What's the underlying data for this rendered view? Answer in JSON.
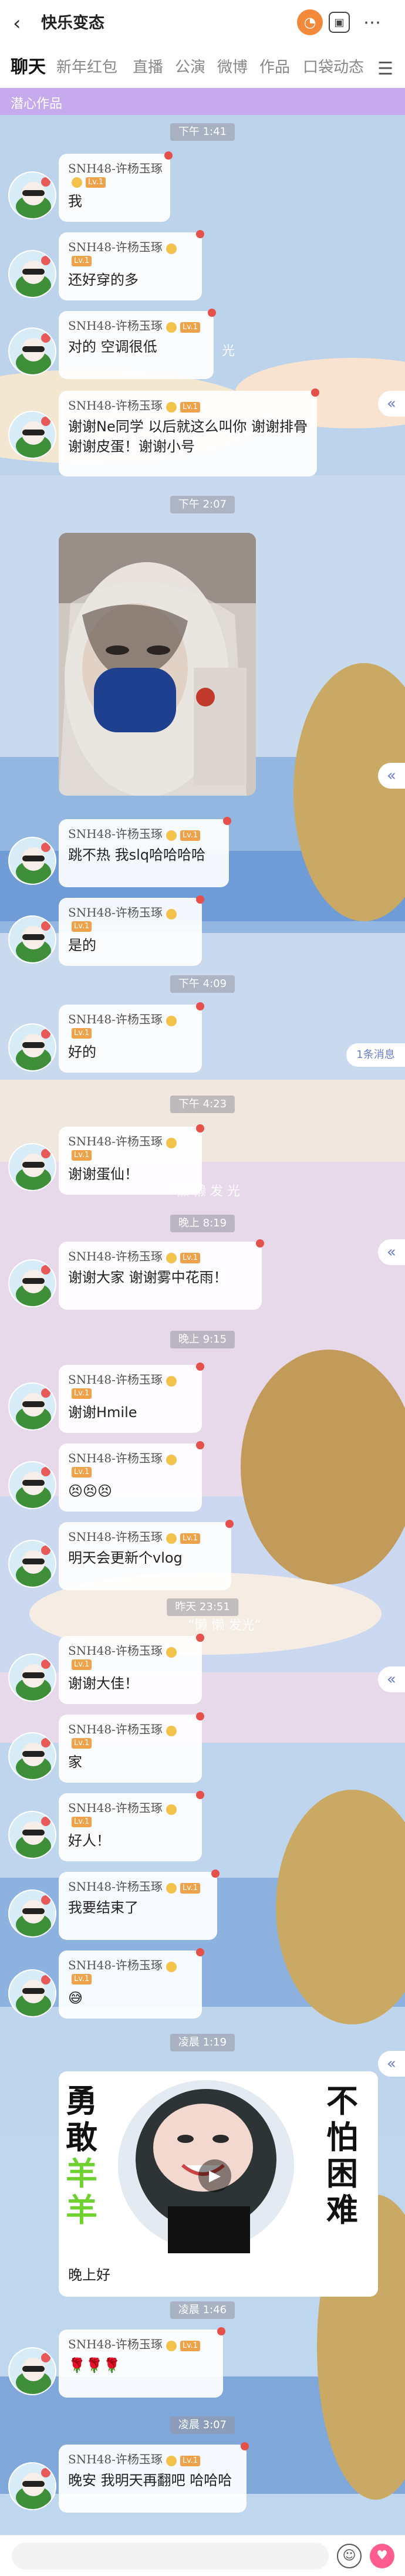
{
  "header": {
    "title": "快乐变态",
    "back_icon": "chevron-left-icon"
  },
  "tabs": [
    "聊天",
    "新年红包",
    "直播",
    "公演",
    "微博",
    "作品",
    "口袋动态"
  ],
  "section_bar": "潜心作品",
  "sender": {
    "name": "SNH48-许杨玉琢",
    "level": "Lv.1"
  },
  "messages": [
    {
      "text": "我"
    },
    {
      "text": "还好穿的多"
    },
    {
      "text": "对的 空调很低"
    },
    {
      "text": "谢谢Ne同学 以后就这么叫你 谢谢排骨 谢谢皮蛋！谢谢小号"
    },
    {
      "text": "跳不热 我slq哈哈哈哈"
    },
    {
      "text": "是的"
    },
    {
      "text": "好的"
    },
    {
      "text": "谢谢蛋仙！"
    },
    {
      "text": "谢谢大家 谢谢雾中花雨！"
    },
    {
      "text": "谢谢Hmile"
    },
    {
      "text": "😣😣😣"
    },
    {
      "text": "明天会更新个vlog"
    },
    {
      "text": "谢谢大佳！"
    },
    {
      "text": "家"
    },
    {
      "text": "好人！"
    },
    {
      "text": "我要结束了"
    },
    {
      "text": "😅"
    },
    {
      "text": "晚上好"
    },
    {
      "text": "🌹🌹🌹"
    },
    {
      "text": "晚安 我明天再翻吧 哈哈哈"
    }
  ],
  "times": [
    "下午 1:41",
    "下午 2:07",
    "下午 4:09",
    "下午 4:23",
    "晚上 8:19",
    "晚上 9:15",
    "昨天 23:51",
    "凌晨 1:19",
    "凌晨 1:46",
    "凌晨 3:07"
  ],
  "new_messages": "1条消息",
  "sticker_text": {
    "left1": "勇",
    "left2": "敢",
    "left3": "羊",
    "left4": "羊",
    "right1": "不",
    "right2": "怕",
    "right3": "困",
    "right4": "难"
  },
  "deco_text": [
    "懒 懒 发 光",
    "“懒 懒 发光”",
    "光"
  ],
  "side_button": "«"
}
